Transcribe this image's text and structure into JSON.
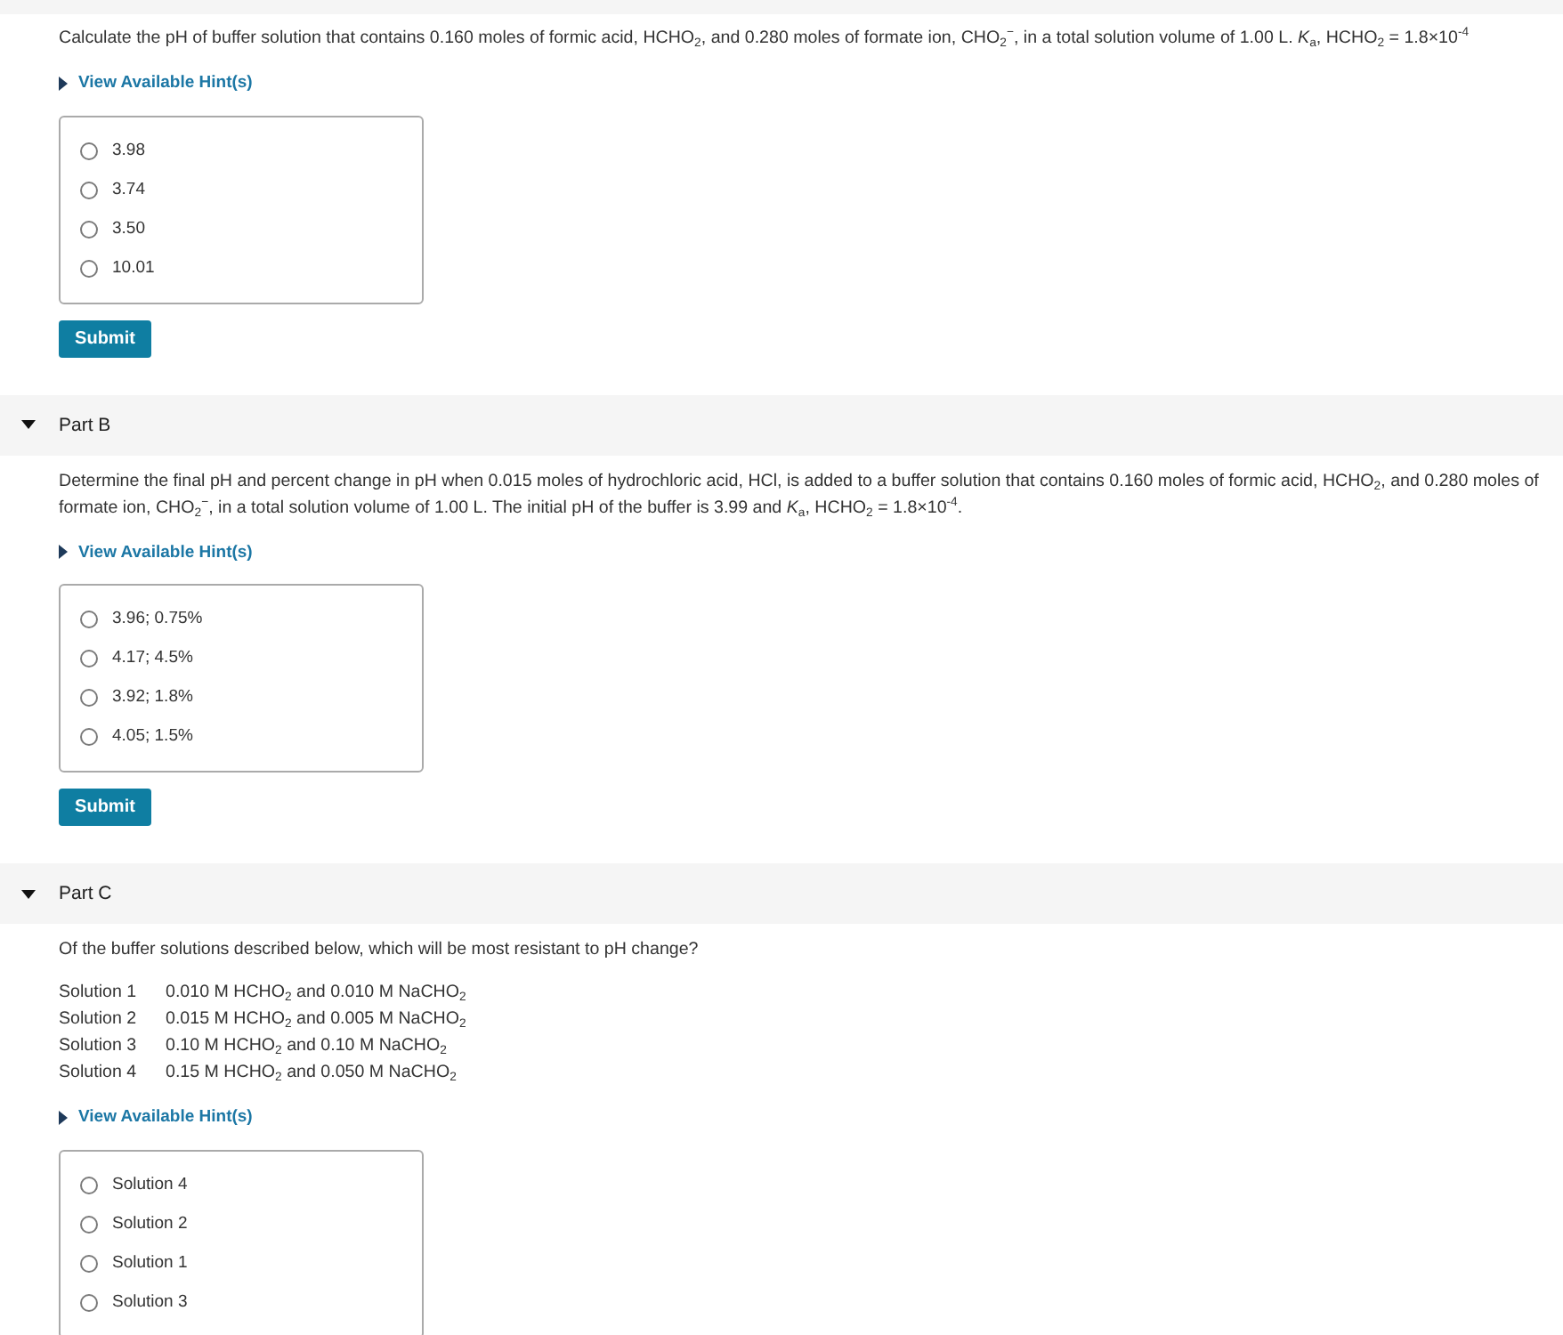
{
  "parts": [
    {
      "question": "Calculate the pH of buffer solution that contains 0.160 moles of formic acid, HCHO$_{2}$, and 0.280 moles of formate ion, CHO$_{2}$$^{−}$, in a total solution volume of 1.00 L. *K*$_{a}$, HCHO$_{2}$ = 1.8×10$^{-4}$",
      "hint": {
        "label": "View Available Hint(s)",
        "expanded": false
      },
      "options": [
        {
          "label": "3.98",
          "selected": false
        },
        {
          "label": "3.74",
          "selected": false
        },
        {
          "label": "3.50",
          "selected": false
        },
        {
          "label": "10.01",
          "selected": false
        }
      ],
      "submit": "Submit"
    },
    {
      "header": {
        "title": "Part B",
        "expanded": true
      },
      "question": "Determine the final pH and percent change in pH when 0.015 moles of hydrochloric acid, HCl, is added to a buffer solution that contains 0.160 moles of formic acid, HCHO$_{2}$, and 0.280 moles of formate ion, CHO$_{2}$$^{−}$, in a total solution volume of 1.00 L. The initial pH of the buffer is 3.99 and *K*$_{a}$, HCHO$_{2}$ = 1.8×10$^{-4}$.",
      "hint": {
        "label": "View Available Hint(s)",
        "expanded": false
      },
      "options": [
        {
          "label": "3.96; 0.75%",
          "selected": false
        },
        {
          "label": "4.17; 4.5%",
          "selected": false
        },
        {
          "label": "3.92; 1.8%",
          "selected": false
        },
        {
          "label": "4.05; 1.5%",
          "selected": false
        }
      ],
      "submit": "Submit"
    },
    {
      "header": {
        "title": "Part C",
        "expanded": true
      },
      "question": "Of the buffer solutions described below, which will be most resistant to pH change?",
      "solutions": [
        {
          "label": "Solution 1",
          "description": "0.010 M HCHO$_{2}$ and 0.010 M NaCHO$_{2}$"
        },
        {
          "label": "Solution 2",
          "description": "0.015 M HCHO$_{2}$ and 0.005 M NaCHO$_{2}$"
        },
        {
          "label": "Solution 3",
          "description": "0.10 M HCHO$_{2}$ and 0.10 M NaCHO$_{2}$"
        },
        {
          "label": "Solution 4",
          "description": "0.15 M HCHO$_{2}$ and 0.050 M NaCHO$_{2}$"
        }
      ],
      "hint": {
        "label": "View Available Hint(s)",
        "expanded": false
      },
      "options": [
        {
          "label": "Solution 4",
          "selected": false
        },
        {
          "label": "Solution 2",
          "selected": false
        },
        {
          "label": "Solution 1",
          "selected": false
        },
        {
          "label": "Solution 3",
          "selected": false
        }
      ]
    }
  ]
}
